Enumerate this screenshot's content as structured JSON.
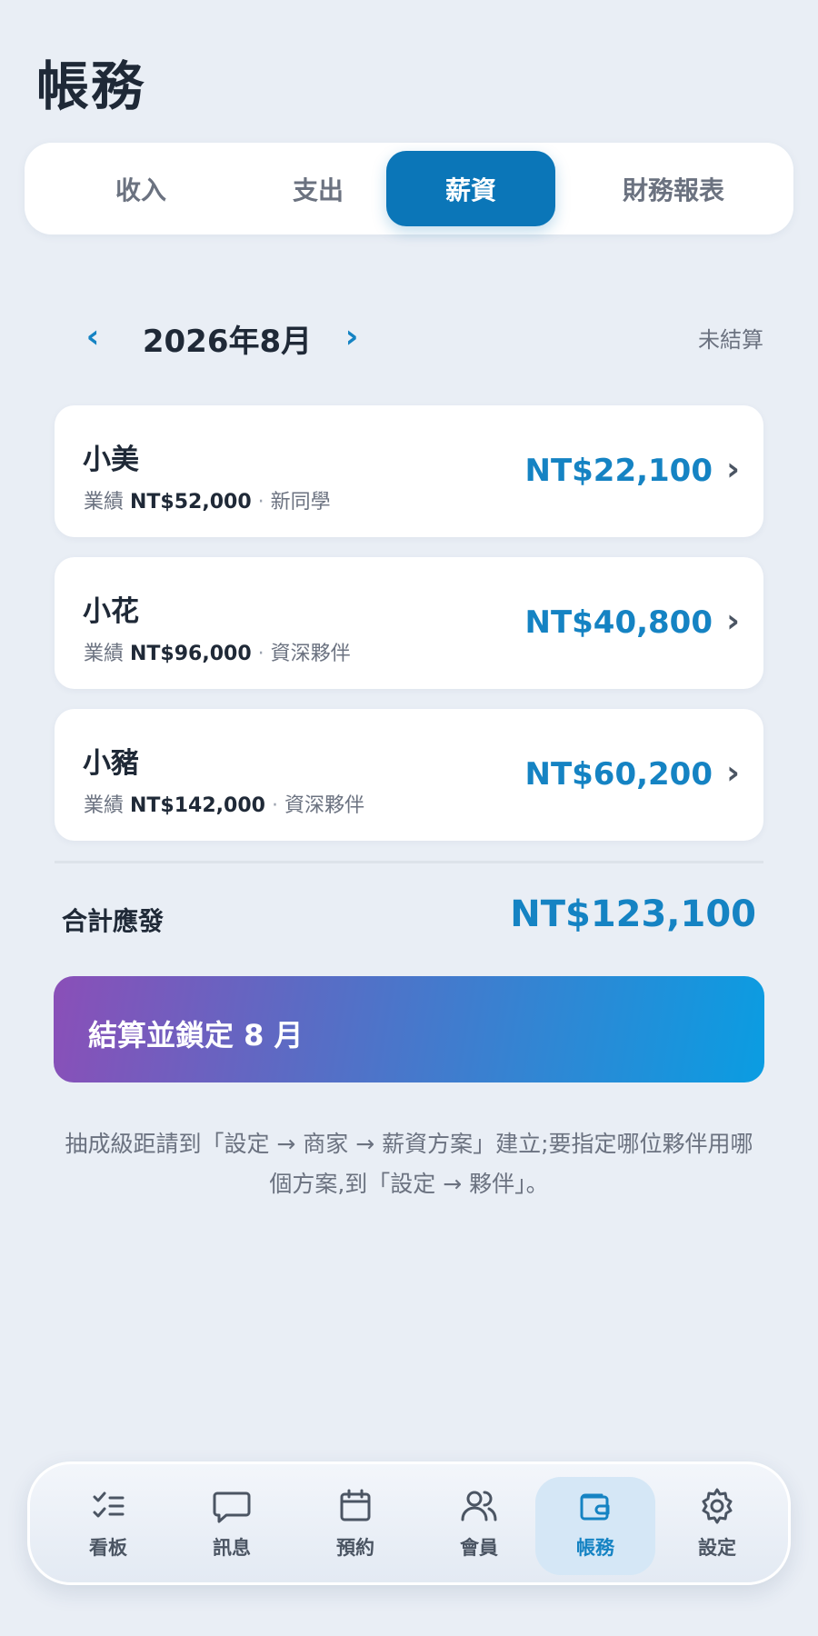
{
  "page": {
    "title": "帳務"
  },
  "tabs": [
    {
      "label": "收入"
    },
    {
      "label": "支出"
    },
    {
      "label": "薪資",
      "active": true
    },
    {
      "label": "財務報表"
    }
  ],
  "month": {
    "prev_icon": "‹",
    "next_icon": "›",
    "label": "2026年8月",
    "status": "未結算"
  },
  "staff": [
    {
      "name": "小美",
      "perf_label": "業績",
      "perf_value": "NT$52,000",
      "level": "新同學",
      "amount": "NT$22,100"
    },
    {
      "name": "小花",
      "perf_label": "業績",
      "perf_value": "NT$96,000",
      "level": "資深夥伴",
      "amount": "NT$40,800"
    },
    {
      "name": "小豬",
      "perf_label": "業績",
      "perf_value": "NT$142,000",
      "level": "資深夥伴",
      "amount": "NT$60,200"
    }
  ],
  "summary": {
    "total_label": "合計應發",
    "total_value": "NT$123,100"
  },
  "settle_button": {
    "label": "結算並鎖定 8 月"
  },
  "hint": "抽成級距請到「設定 → 商家 → 薪資方案」建立;要指定哪位夥伴用哪個方案,到「設定 → 夥伴」。",
  "colors": {
    "accent": "#1583c3",
    "tab_active": "#0b76b8",
    "gradient_start": "#8a4fb8",
    "gradient_end": "#0a9de2"
  },
  "nav": [
    {
      "label": "看板",
      "icon": "checklist-icon"
    },
    {
      "label": "訊息",
      "icon": "chat-bubble-icon"
    },
    {
      "label": "預約",
      "icon": "calendar-icon"
    },
    {
      "label": "會員",
      "icon": "users-icon"
    },
    {
      "label": "帳務",
      "icon": "wallet-icon",
      "active": true
    },
    {
      "label": "設定",
      "icon": "gear-icon"
    }
  ]
}
